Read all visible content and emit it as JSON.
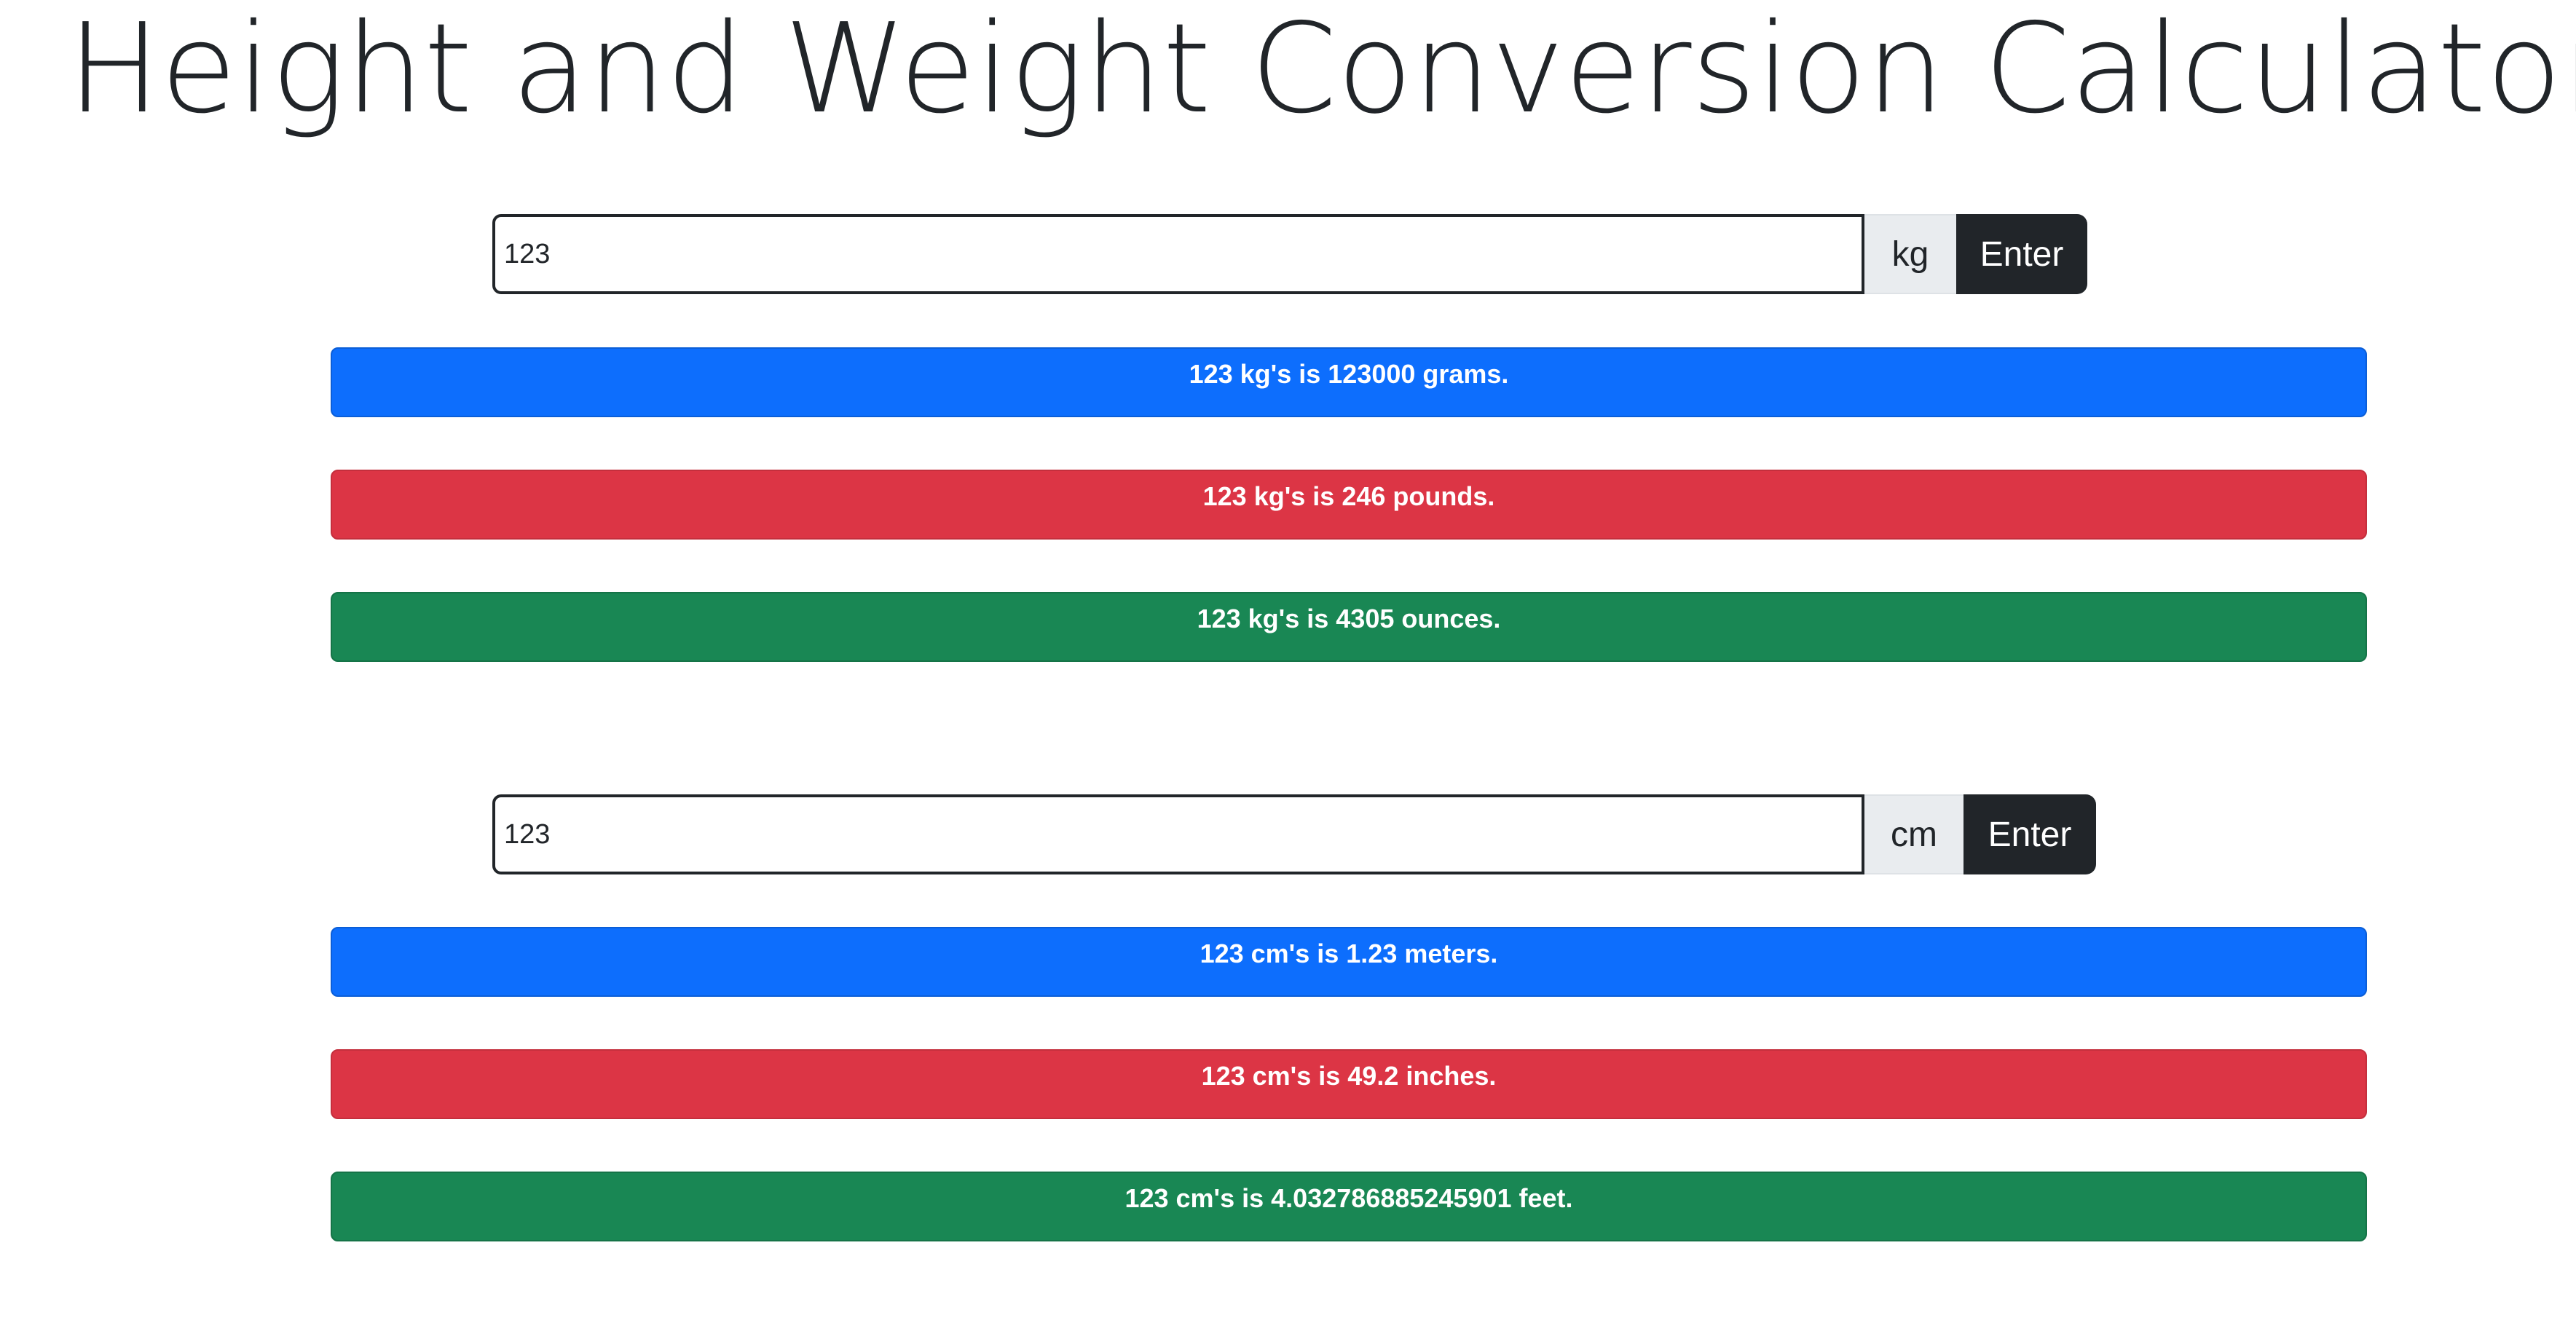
{
  "page": {
    "title": "Height and Weight Conversion Calculator"
  },
  "weight": {
    "input_value": "123",
    "unit_label": "kg",
    "enter_label": "Enter",
    "results": [
      "123 kg's is 123000 grams.",
      "123 kg's is 246 pounds.",
      "123 kg's is 4305 ounces."
    ]
  },
  "height": {
    "input_value": "123",
    "unit_label": "cm",
    "enter_label": "Enter",
    "results": [
      "123 cm's is 1.23 meters.",
      "123 cm's is 49.2 inches.",
      "123 cm's is 4.032786885245901 feet."
    ]
  },
  "colors": {
    "primary": "#0d6efd",
    "danger": "#dc3545",
    "success": "#198754",
    "dark": "#212529",
    "addon": "#e9ecef"
  }
}
